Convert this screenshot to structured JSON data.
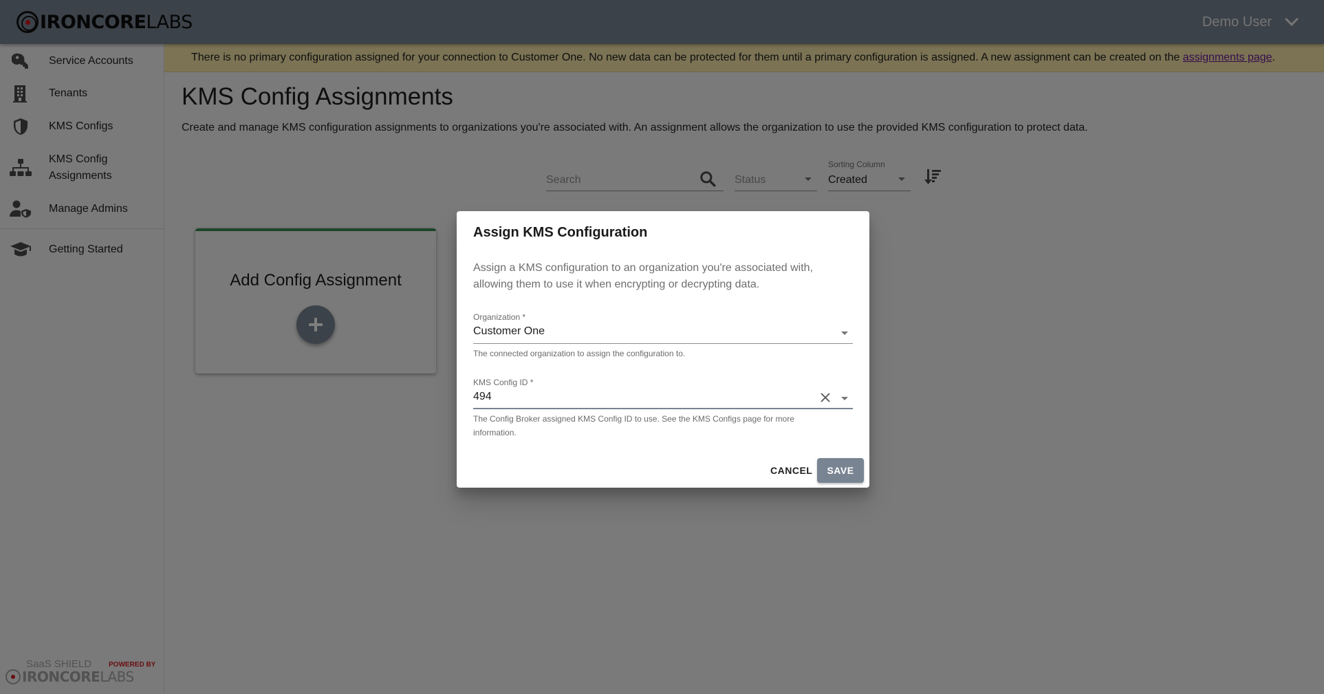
{
  "header": {
    "logo_bold": "IRONCORE",
    "logo_light": "LABS",
    "user_name": "Demo User"
  },
  "banner": {
    "message": "There is no primary configuration assigned for your connection to Customer One. No new data can be protected for them until a primary configuration is assigned. A new assignment can be created on the ",
    "link_text": "assignments page",
    "suffix": "."
  },
  "sidebar": {
    "items": [
      {
        "label": "Service Accounts",
        "icon": "key-icon"
      },
      {
        "label": "Tenants",
        "icon": "building-icon"
      },
      {
        "label": "KMS Configs",
        "icon": "shield-icon"
      },
      {
        "label": "KMS Config Assignments",
        "icon": "sitemap-icon"
      },
      {
        "label": "Manage Admins",
        "icon": "admin-user-icon"
      },
      {
        "label": "Getting Started",
        "icon": "graduation-cap-icon"
      }
    ],
    "footer": {
      "product": "SaaS SHIELD",
      "powered_by": "POWERED BY",
      "brand_bold": "IRONCORE",
      "brand_light": "LABS"
    }
  },
  "page": {
    "title": "KMS Config Assignments",
    "description": "Create and manage KMS configuration assignments to organizations you're associated with. An assignment allows the organization to use the provided KMS configuration to protect data."
  },
  "filters": {
    "search_placeholder": "Search",
    "status_placeholder": "Status",
    "sort_label": "Sorting Column",
    "sort_value": "Created"
  },
  "add_card": {
    "title": "Add Config Assignment"
  },
  "dialog": {
    "title": "Assign KMS Configuration",
    "text": "Assign a KMS configuration to an organization you're associated with, allowing them to use it when encrypting or decrypting data.",
    "organization": {
      "label": "Organization *",
      "value": "Customer One",
      "helper": "The connected organization to assign the configuration to."
    },
    "kms_config": {
      "label": "KMS Config ID *",
      "value": "494",
      "helper": "The Config Broker assigned KMS Config ID to use. See the KMS Configs page for more information."
    },
    "cancel_label": "CANCEL",
    "save_label": "SAVE"
  },
  "colors": {
    "primary": "#788492",
    "card_accent": "#3a8a4e",
    "banner_bg": "#f6e6a8",
    "brand_red": "#d21e24"
  }
}
